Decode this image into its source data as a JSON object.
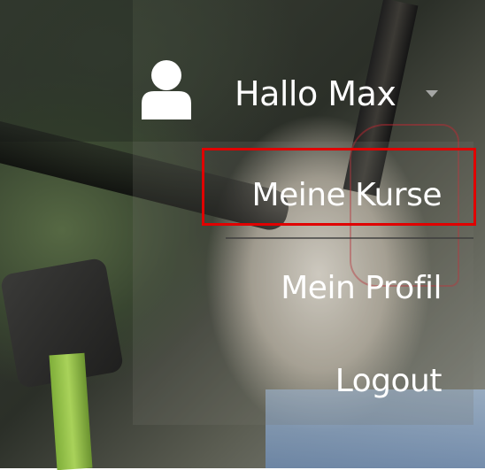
{
  "header": {
    "greeting": "Hallo Max",
    "user_icon": "user-icon",
    "dropdown_icon": "caret-down-icon"
  },
  "menu": {
    "items": [
      {
        "label": "Meine Kurse",
        "highlighted": true
      },
      {
        "label": "Mein Profil",
        "highlighted": false
      },
      {
        "label": "Logout",
        "highlighted": false
      }
    ]
  },
  "colors": {
    "text": "#ffffff",
    "highlight_border": "#e00000",
    "caret": "#c8c8c8"
  }
}
